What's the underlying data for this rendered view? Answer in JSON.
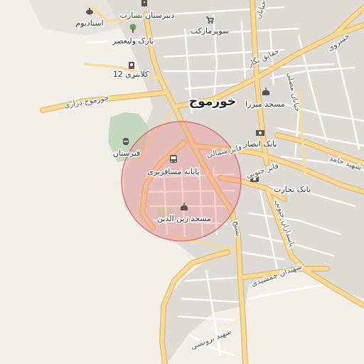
{
  "map": {
    "colors": {
      "land": "#f2efe9",
      "urban": "#dcd9d5",
      "road_major": "#f4d28a",
      "road_major_casing": "#e5b866",
      "road_minor": "#ffffff",
      "green": "#cfe3c5",
      "cemetery": "#bcd3b6",
      "highlight_fill": "#f08a8a",
      "highlight_stroke": "#d96060"
    },
    "labels": {
      "city": "خورموج",
      "school_boshrat": "دبیرستان بشارت",
      "stadium": "استادیوم",
      "supermarket": "سوپرمارکت",
      "park_valiasr": "پارک ولیعصر",
      "police_12": "کلانتری 12",
      "mosque_mirza": "مسجد میرزا",
      "bank_ansar": "بانک انصار",
      "bank_tejarat": "بانک تجارت",
      "cemetery": "قبرستان",
      "bus_terminal": "پایانه مسافربری",
      "mosque_zeinoddin": "مسجد زین الدین",
      "road_darai": "خورموج دراری",
      "road_haghayegh": "حقایق نگار",
      "road_khosravi": "خسروی",
      "road_faez_shomali": "فایز شمالی",
      "road_faez_jonubi": "فایز جنوبی",
      "road_pasdaran": "پاسداران جنوبی",
      "road_shahidan": "شهیدان جمشیدی",
      "road_borunsi": "شهید برونسی",
      "road_hamed": "شهید حامد",
      "road_moslem": "خیابان مصلی",
      "road_basij": "بسیج",
      "road_khayaban": "خیابان"
    },
    "icons": {
      "school": "school-icon",
      "stadium": "stadium-icon",
      "supermarket": "cart-icon",
      "park": "tree-icon",
      "police": "police-icon",
      "mosque": "mosque-icon",
      "bank": "bank-icon",
      "cemetery": "cemetery-icon",
      "bus": "bus-icon"
    }
  }
}
